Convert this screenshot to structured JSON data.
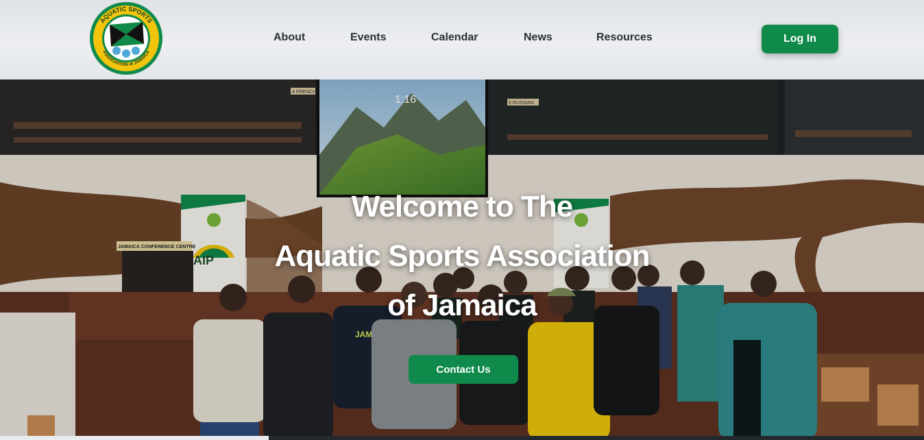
{
  "header": {
    "logo": {
      "top_text": "AQUATIC SPORTS",
      "bottom_text": "ASSOCIATION of JAMAICA",
      "colors": {
        "green": "#0f8a4a",
        "gold": "#f2c40c",
        "black": "#111111",
        "blue": "#4fa8d8"
      }
    },
    "nav": [
      {
        "label": "About"
      },
      {
        "label": "Events"
      },
      {
        "label": "Calendar"
      },
      {
        "label": "News"
      },
      {
        "label": "Resources"
      }
    ],
    "login_label": "Log In"
  },
  "hero": {
    "title_lines": [
      "Welcome to The",
      "Aquatic Sports Association",
      "of Jamaica"
    ],
    "contact_label": "Contact Us",
    "photo_signs": {
      "screen_time": "1:16",
      "podium_sign": "JAMAICA CONFERENCE CENTRE",
      "banner_text": "JAIP",
      "shirt_text": "JAMA",
      "room_labels": [
        "4 FRENCH",
        "5 RUSSIAN"
      ]
    }
  },
  "theme": {
    "accent": "#0f8a4a",
    "header_bg": "#e6e8eb",
    "nav_text": "#2b2f36"
  }
}
